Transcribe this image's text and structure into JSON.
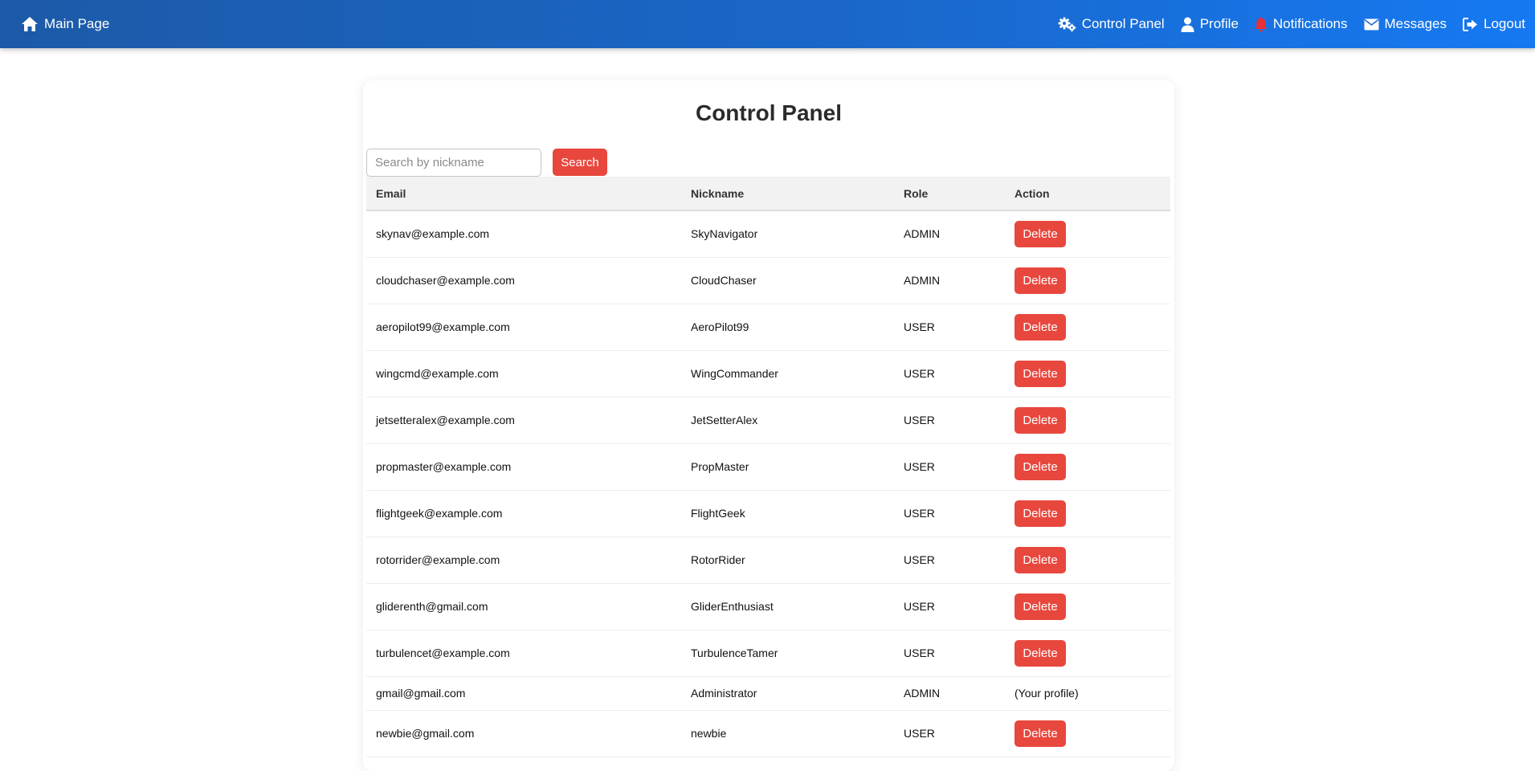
{
  "nav": {
    "home_label": "Main Page",
    "links": [
      {
        "label": "Control Panel",
        "icon": "gears-icon"
      },
      {
        "label": "Profile",
        "icon": "user-icon"
      },
      {
        "label": "Notifications",
        "icon": "bell-icon"
      },
      {
        "label": "Messages",
        "icon": "envelope-icon"
      },
      {
        "label": "Logout",
        "icon": "sign-out-icon"
      }
    ]
  },
  "colors": {
    "nav_gradient_start": "#1c5aa8",
    "nav_gradient_end": "#1679f2",
    "accent_red": "#e8473d",
    "notification_bell": "#e8303a"
  },
  "panel": {
    "title": "Control Panel",
    "search": {
      "placeholder": "Search by nickname",
      "value": "",
      "button_label": "Search"
    },
    "table": {
      "headers": [
        "Email",
        "Nickname",
        "Role",
        "Action"
      ],
      "delete_label": "Delete",
      "own_profile_label": "(Your profile)",
      "rows": [
        {
          "email": "skynav@example.com",
          "nickname": "SkyNavigator",
          "role": "ADMIN",
          "own": false
        },
        {
          "email": "cloudchaser@example.com",
          "nickname": "CloudChaser",
          "role": "ADMIN",
          "own": false
        },
        {
          "email": "aeropilot99@example.com",
          "nickname": "AeroPilot99",
          "role": "USER",
          "own": false
        },
        {
          "email": "wingcmd@example.com",
          "nickname": "WingCommander",
          "role": "USER",
          "own": false
        },
        {
          "email": "jetsetteralex@example.com",
          "nickname": "JetSetterAlex",
          "role": "USER",
          "own": false
        },
        {
          "email": "propmaster@example.com",
          "nickname": "PropMaster",
          "role": "USER",
          "own": false
        },
        {
          "email": "flightgeek@example.com",
          "nickname": "FlightGeek",
          "role": "USER",
          "own": false
        },
        {
          "email": "rotorrider@example.com",
          "nickname": "RotorRider",
          "role": "USER",
          "own": false
        },
        {
          "email": "gliderenth@gmail.com",
          "nickname": "GliderEnthusiast",
          "role": "USER",
          "own": false
        },
        {
          "email": "turbulencet@example.com",
          "nickname": "TurbulenceTamer",
          "role": "USER",
          "own": false
        },
        {
          "email": "gmail@gmail.com",
          "nickname": "Administrator",
          "role": "ADMIN",
          "own": true
        },
        {
          "email": "newbie@gmail.com",
          "nickname": "newbie",
          "role": "USER",
          "own": false
        }
      ]
    }
  }
}
